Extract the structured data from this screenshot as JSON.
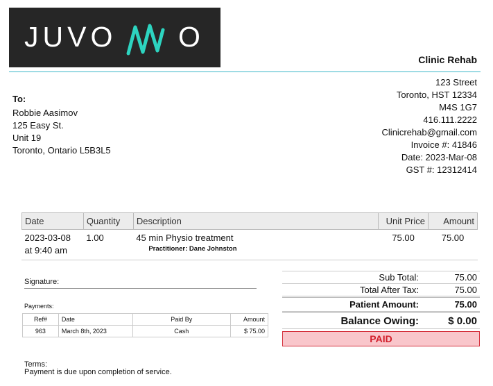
{
  "logo": {
    "text": "JUVONNO",
    "letters_left": "JUVO",
    "letter_right": "O",
    "wave_color": "#2dd4c0"
  },
  "clinic": {
    "name": "Clinic Rehab",
    "street": "123 Street",
    "city_line": "Toronto, HST 12334",
    "postal": "M4S 1G7",
    "phone": "416.111.2222",
    "email": "Clinicrehab@gmail.com",
    "invoice": "Invoice #: 41846",
    "date": "Date: 2023-Mar-08",
    "gst": "GST #: 12312414"
  },
  "bill_to": {
    "label": "To:",
    "name": "Robbie Aasimov",
    "address1": "125 Easy St.",
    "address2": "Unit 19",
    "city": "Toronto, Ontario L5B3L5"
  },
  "items": {
    "headers": {
      "date": "Date",
      "quantity": "Quantity",
      "description": "Description",
      "unit_price": "Unit Price",
      "amount": "Amount"
    },
    "rows": [
      {
        "date": "2023-03-08",
        "time": "at 9:40 am",
        "quantity": "1.00",
        "description": "45 min Physio treatment",
        "practitioner": "Practitioner: Dane Johnston",
        "unit_price": "75.00",
        "amount": "75.00"
      }
    ]
  },
  "signature_label": "Signature:",
  "payments": {
    "label": "Payments:",
    "headers": {
      "ref": "Ref#",
      "date": "Date",
      "paid_by": "Paid By",
      "amount": "Amount"
    },
    "rows": [
      {
        "ref": "963",
        "date": "March 8th, 2023",
        "paid_by": "Cash",
        "amount": "$ 75.00"
      }
    ]
  },
  "totals": {
    "sub_total_label": "Sub Total:",
    "sub_total": "75.00",
    "after_tax_label": "Total After Tax:",
    "after_tax": "75.00",
    "patient_label": "Patient Amount:",
    "patient": "75.00",
    "balance_label": "Balance Owing:",
    "balance": "$ 0.00",
    "status": "PAID"
  },
  "terms": {
    "label": "Terms:",
    "text": "Payment is due upon completion of service."
  }
}
